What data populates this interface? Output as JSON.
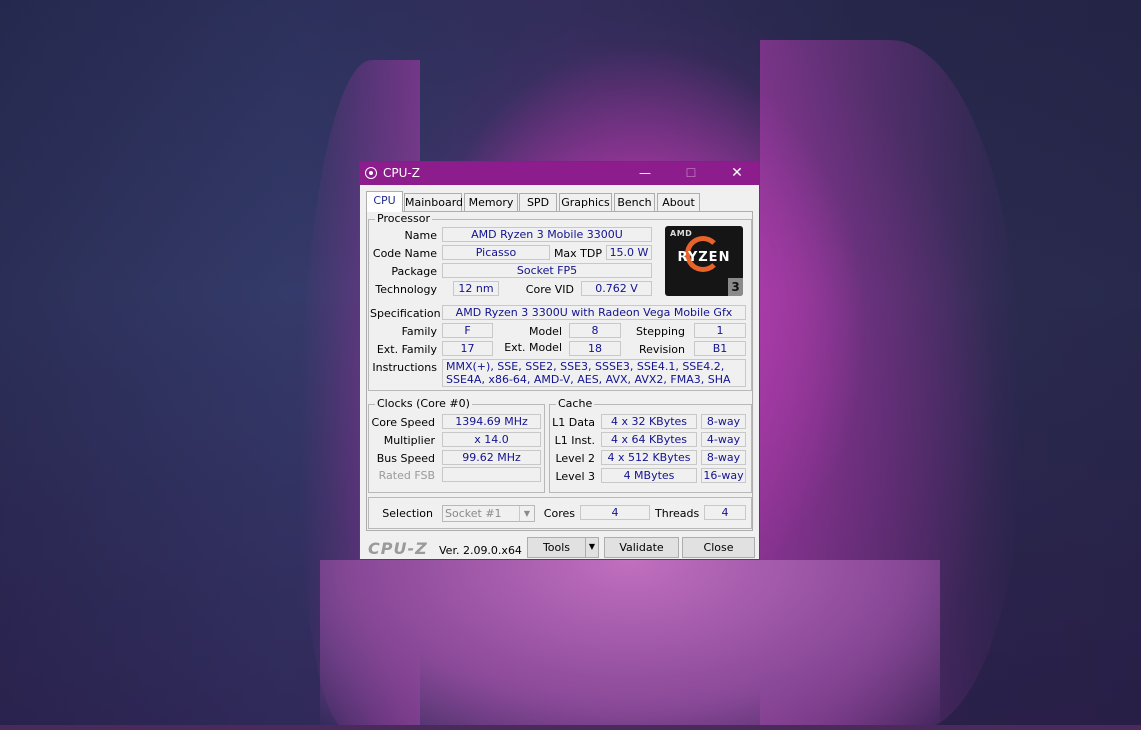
{
  "window": {
    "title": "CPU-Z",
    "minimize": "—",
    "maximize": "☐",
    "close": "✕"
  },
  "tabs": [
    {
      "label": "CPU",
      "active": true
    },
    {
      "label": "Mainboard"
    },
    {
      "label": "Memory"
    },
    {
      "label": "SPD"
    },
    {
      "label": "Graphics"
    },
    {
      "label": "Bench"
    },
    {
      "label": "About"
    }
  ],
  "processor": {
    "group_title": "Processor",
    "name_label": "Name",
    "name": "AMD Ryzen 3 Mobile 3300U",
    "code_name_label": "Code Name",
    "code_name": "Picasso",
    "max_tdp_label": "Max TDP",
    "max_tdp": "15.0 W",
    "package_label": "Package",
    "package": "Socket FP5",
    "technology_label": "Technology",
    "technology": "12 nm",
    "core_vid_label": "Core VID",
    "core_vid": "0.762 V",
    "specification_label": "Specification",
    "specification": "AMD Ryzen 3 3300U with Radeon Vega Mobile Gfx",
    "family_label": "Family",
    "family": "F",
    "model_label": "Model",
    "model": "8",
    "stepping_label": "Stepping",
    "stepping": "1",
    "ext_family_label": "Ext. Family",
    "ext_family": "17",
    "ext_model_label": "Ext. Model",
    "ext_model": "18",
    "revision_label": "Revision",
    "revision": "B1",
    "instructions_label": "Instructions",
    "instructions": "MMX(+), SSE, SSE2, SSE3, SSSE3, SSE4.1, SSE4.2, SSE4A, x86-64, AMD-V, AES, AVX, AVX2, FMA3, SHA",
    "logo": {
      "brand": "AMD",
      "series": "RYZEN",
      "tier": "3",
      "accent": "#e8632a"
    }
  },
  "clocks": {
    "group_title": "Clocks (Core #0)",
    "core_speed_label": "Core Speed",
    "core_speed": "1394.69 MHz",
    "multiplier_label": "Multiplier",
    "multiplier": "x 14.0",
    "bus_speed_label": "Bus Speed",
    "bus_speed": "99.62 MHz",
    "rated_fsb_label": "Rated FSB",
    "rated_fsb": ""
  },
  "cache": {
    "group_title": "Cache",
    "rows": [
      {
        "label": "L1 Data",
        "size": "4 x 32 KBytes",
        "assoc": "8-way"
      },
      {
        "label": "L1 Inst.",
        "size": "4 x 64 KBytes",
        "assoc": "4-way"
      },
      {
        "label": "Level 2",
        "size": "4 x 512 KBytes",
        "assoc": "8-way"
      },
      {
        "label": "Level 3",
        "size": "4 MBytes",
        "assoc": "16-way"
      }
    ]
  },
  "selection": {
    "selection_label": "Selection",
    "selection_value": "Socket #1",
    "cores_label": "Cores",
    "cores": "4",
    "threads_label": "Threads",
    "threads": "4"
  },
  "footer": {
    "logo_text": "CPU-Z",
    "version": "Ver. 2.09.0.x64",
    "tools_label": "Tools",
    "validate_label": "Validate",
    "close_label": "Close"
  },
  "colors": {
    "titlebar": "#8d1d8d",
    "value_text": "#13138f"
  }
}
